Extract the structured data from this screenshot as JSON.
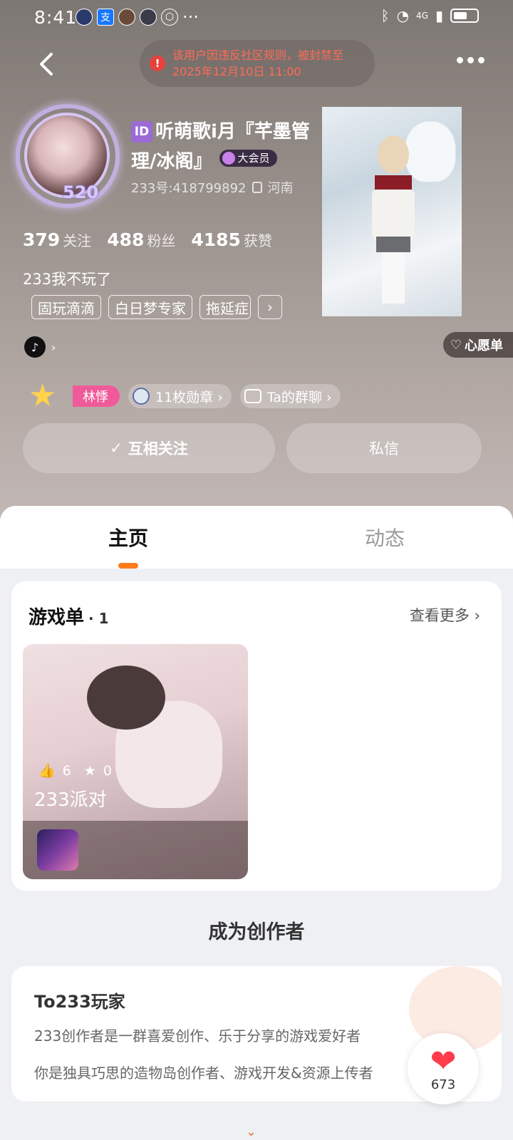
{
  "status_bar": {
    "time": "8:41",
    "network": "4G",
    "app_icons": [
      "app-icon",
      "alipay-icon",
      "app-icon",
      "app-icon",
      "app-icon"
    ],
    "more": "···"
  },
  "header": {
    "ban_notice_line1": "该用户因违反社区规则，被封禁至",
    "ban_notice_line2": "2025年12月10日 11:00"
  },
  "profile": {
    "id_badge": "ID",
    "username": "听萌歌i月『芊墨管理/冰阁』",
    "vip_label": "大会员",
    "user_id": "233号:418799892",
    "location": "河南",
    "avatar_badge": "520",
    "stats": [
      {
        "num": "379",
        "label": "关注"
      },
      {
        "num": "488",
        "label": "粉丝"
      },
      {
        "num": "4185",
        "label": "获赞"
      }
    ],
    "bio": "233我不玩了",
    "tags": [
      "固玩滴滴",
      "白日梦专家",
      "拖延症"
    ],
    "tag_more": "›",
    "wishlist_label": "心愿单",
    "tiktok_arrow": "›",
    "name_tag": "林悸",
    "medals_label": "11枚勋章 ›",
    "group_chat_label": "Ta的群聊 ›",
    "follow_label": "互相关注",
    "follow_check": "✓",
    "message_label": "私信"
  },
  "tabs": [
    {
      "label": "主页",
      "active": true
    },
    {
      "label": "动态",
      "active": false
    }
  ],
  "playlist": {
    "title": "游戏单",
    "count": "· 1",
    "more_label": "查看更多 ›",
    "item": {
      "likes": "6",
      "stars": "0",
      "name": "233派对"
    }
  },
  "creator": {
    "section_title": "成为创作者",
    "card_title": "To233玩家",
    "line1": "233创作者是一群喜爱创作、乐于分享的游戏爱好者",
    "line2": "你是独具巧思的造物岛创作者、游戏开发&资源上传者"
  },
  "floating_like": {
    "count": "673"
  },
  "colors": {
    "accent": "#ff7a1a",
    "ban_text": "#ff6a58",
    "name_tag": "#f05a9a",
    "heart": "#ff3b4c"
  }
}
